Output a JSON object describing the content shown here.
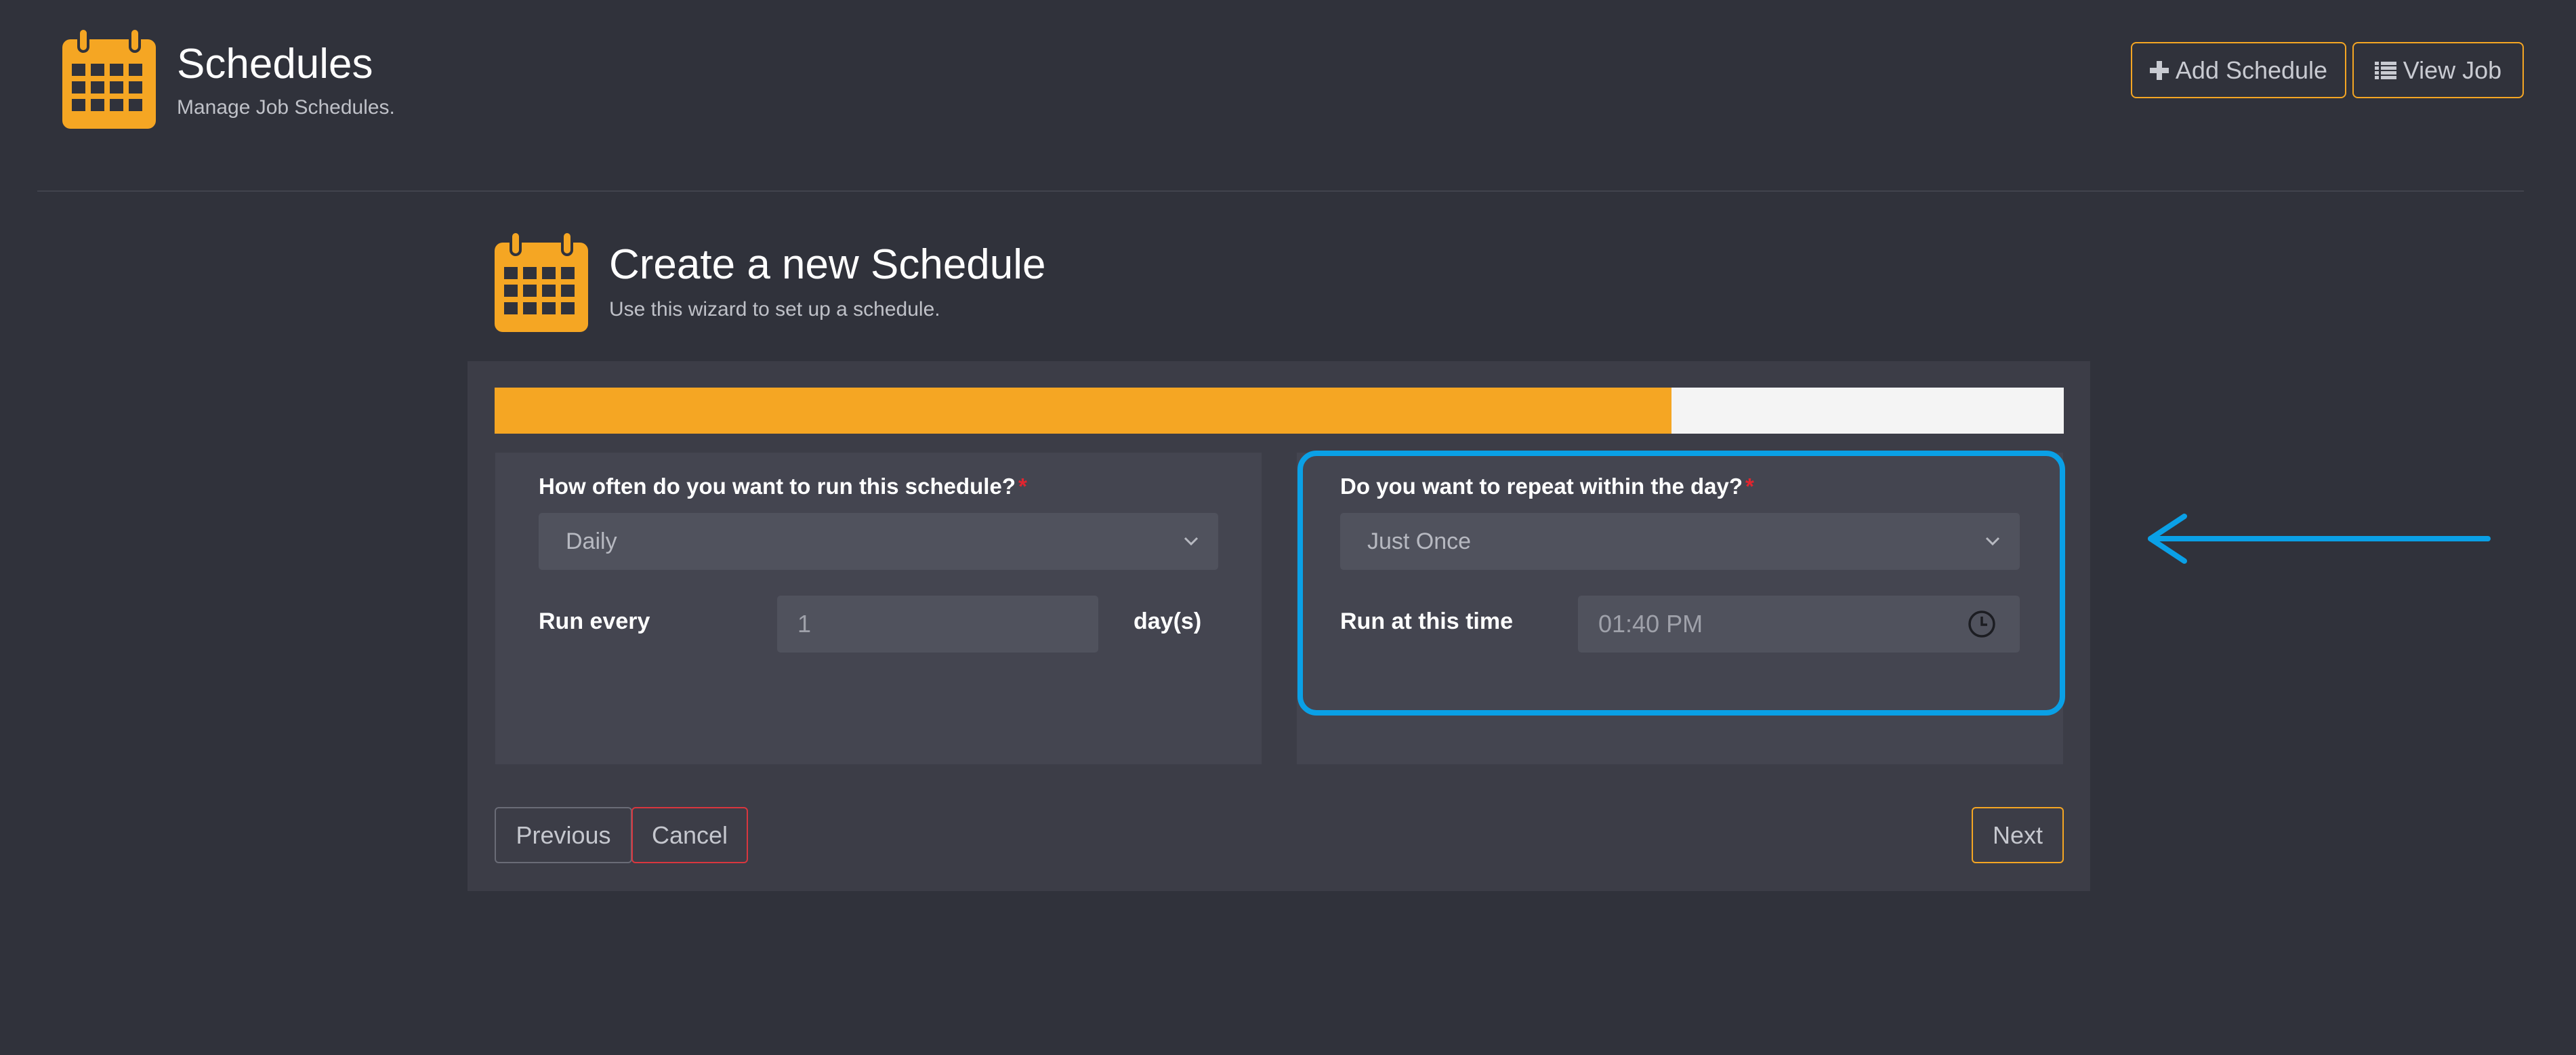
{
  "colors": {
    "background": "#30323b",
    "accent": "#f5a623",
    "highlight": "#0aa0e6",
    "danger": "#d9363e",
    "required": "#e0252f"
  },
  "header": {
    "icon": "calendar-icon",
    "title": "Schedules",
    "subtitle": "Manage Job Schedules.",
    "buttons": {
      "add_schedule": {
        "icon": "plus-icon",
        "label": "Add Schedule"
      },
      "view_job": {
        "icon": "list-icon",
        "label": "View Job"
      }
    }
  },
  "wizard": {
    "icon": "calendar-icon",
    "title": "Create a new Schedule",
    "subtitle": "Use this wizard to set up a schedule.",
    "progress_percent": 75,
    "frequency": {
      "question": "How often do you want to run this schedule?",
      "required_mark": "*",
      "selected": "Daily",
      "run_every_label": "Run every",
      "run_every_value": "1",
      "unit": "day(s)"
    },
    "repeat": {
      "question": "Do you want to repeat within the day?",
      "required_mark": "*",
      "selected": "Just Once",
      "time_label": "Run at this time",
      "time_value": "01:40 PM",
      "time_icon": "clock-icon"
    },
    "buttons": {
      "previous": "Previous",
      "cancel": "Cancel",
      "next": "Next"
    }
  },
  "annotation": {
    "arrow_icon": "arrow-left-icon"
  }
}
